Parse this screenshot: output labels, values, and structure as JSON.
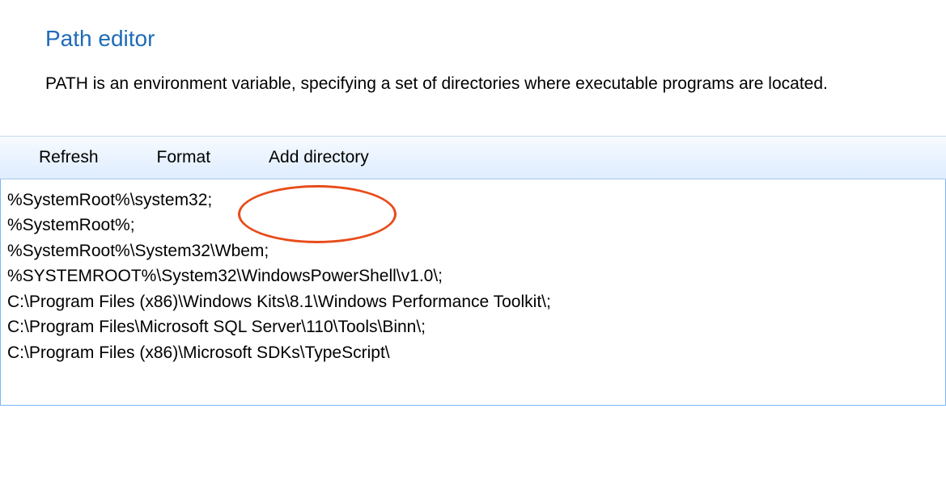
{
  "header": {
    "title": "Path editor",
    "description": "PATH is an environment variable, specifying a set of directories where executable programs are located."
  },
  "toolbar": {
    "refresh_label": "Refresh",
    "format_label": "Format",
    "add_directory_label": "Add directory"
  },
  "editor": {
    "lines": [
      "%SystemRoot%\\system32;",
      "%SystemRoot%;",
      "%SystemRoot%\\System32\\Wbem;",
      "%SYSTEMROOT%\\System32\\WindowsPowerShell\\v1.0\\;",
      "C:\\Program Files (x86)\\Windows Kits\\8.1\\Windows Performance Toolkit\\;",
      "C:\\Program Files\\Microsoft SQL Server\\110\\Tools\\Binn\\;",
      "C:\\Program Files (x86)\\Microsoft SDKs\\TypeScript\\"
    ]
  },
  "annotation": {
    "highlight_color": "#e84c1a"
  }
}
